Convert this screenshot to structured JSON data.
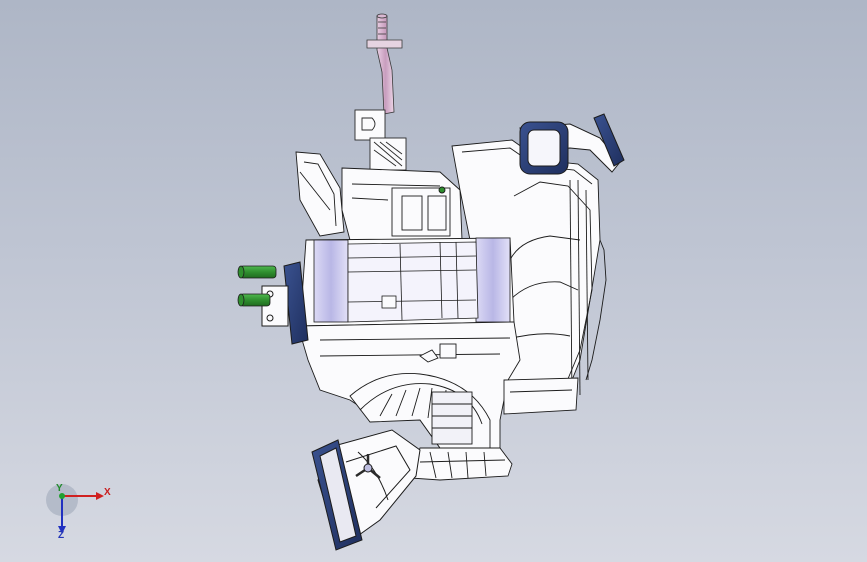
{
  "viewport": {
    "background_top": "#aeb6c6",
    "background_bottom": "#d6d9e2",
    "model": {
      "accent_colors": {
        "flange_blue": "#2a3f78",
        "connector_green": "#2f8f2f",
        "hose_pink": "#d9b8d2",
        "body_white": "#fbfbfd",
        "insert_lilac": "#b9b7e6"
      }
    }
  },
  "triad": {
    "x_label": "X",
    "y_label": "Y",
    "z_label": "Z",
    "x_color": "#d02020",
    "y_color": "#20a030",
    "z_color": "#2030c0"
  }
}
